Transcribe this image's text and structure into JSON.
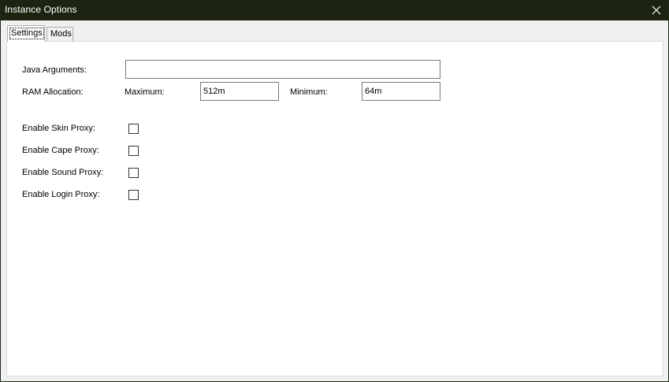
{
  "window": {
    "title": "Instance Options",
    "close_glyph": "✕"
  },
  "tabs": [
    {
      "label": "Settings",
      "active": true
    },
    {
      "label": "Mods",
      "active": false
    }
  ],
  "settings": {
    "java_arguments_label": "Java Arguments:",
    "java_arguments_value": "",
    "ram_allocation_label": "RAM Allocation:",
    "maximum_label": "Maximum:",
    "maximum_value": "512m",
    "minimum_label": "Minimum:",
    "minimum_value": "64m",
    "proxies": [
      {
        "label": "Enable Skin Proxy:",
        "checked": false
      },
      {
        "label": "Enable Cape Proxy:",
        "checked": false
      },
      {
        "label": "Enable Sound Proxy:",
        "checked": false
      },
      {
        "label": "Enable Login Proxy:",
        "checked": false
      }
    ]
  },
  "icons": {
    "close": "close-icon"
  },
  "colors": {
    "titlebar_bg": "#1c2411",
    "titlebar_text": "#ffffff",
    "window_bg": "#f0f0f0",
    "panel_bg": "#ffffff"
  }
}
